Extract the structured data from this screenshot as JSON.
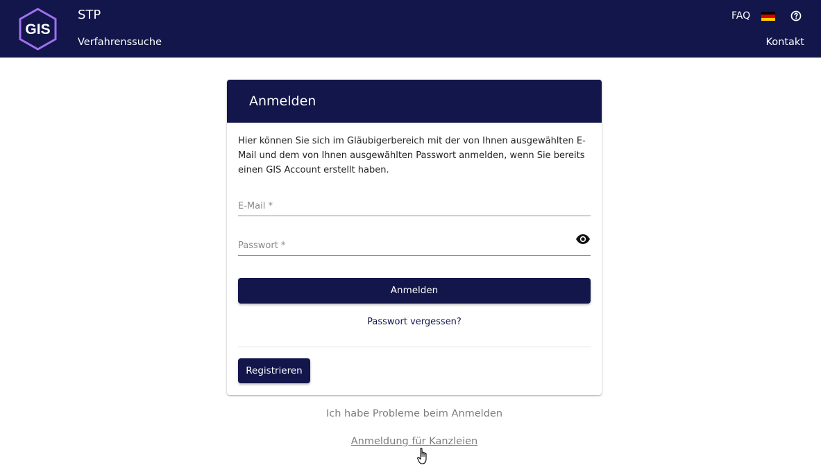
{
  "header": {
    "logo_text": "GIS",
    "app_name": "STP",
    "nav": [
      {
        "label": "Verfahrenssuche"
      }
    ],
    "faq_label": "FAQ",
    "language": "de-flag-icon",
    "help_icon": "help-circle-icon",
    "contact_label": "Kontakt"
  },
  "login_card": {
    "title": "Anmelden",
    "intro": "Hier können Sie sich im Gläubigerbereich mit der von Ihnen ausgewählten E-Mail und dem von Ihnen ausgewählten Passwort anmelden, wenn Sie bereits einen GIS Account erstellt haben.",
    "email_placeholder": "E-Mail *",
    "password_placeholder": "Passwort *",
    "password_toggle_icon": "eye-icon",
    "submit_label": "Anmelden",
    "forgot_label": "Passwort vergessen?",
    "register_label": "Registrieren"
  },
  "below_card": {
    "problems_label": "Ich habe Probleme beim Anmelden",
    "kanzlei_label": "Anmeldung für Kanzleien"
  },
  "colors": {
    "brand_navy": "#12164a",
    "logo_purple": "#a070f0",
    "link_gray": "#7d7d7d"
  }
}
